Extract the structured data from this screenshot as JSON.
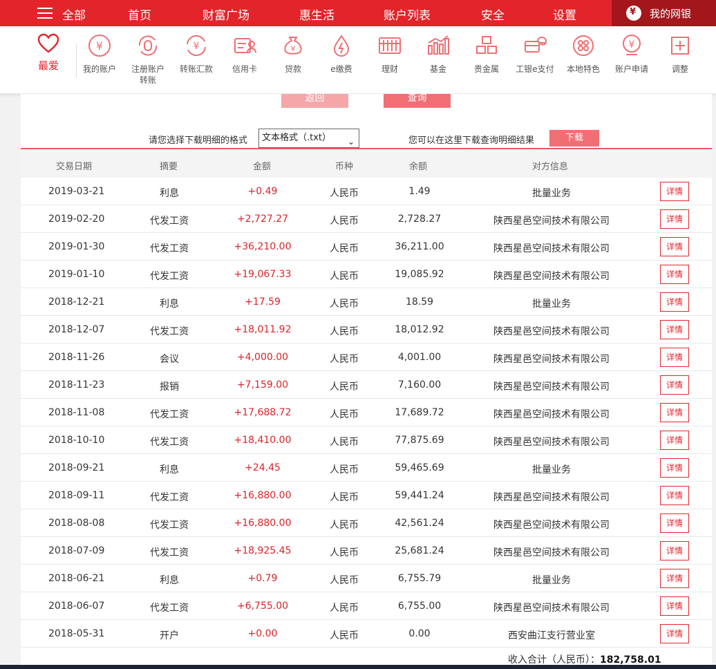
{
  "topnav": {
    "all_label": "全部",
    "items": [
      "首页",
      "财富广场",
      "惠生活",
      "账户列表",
      "安全",
      "设置"
    ],
    "mybank_label": "我的网银"
  },
  "iconbar": {
    "favorite_label": "最爱",
    "items": [
      {
        "label": "我的账户",
        "icon": "yen-circle-icon"
      },
      {
        "label": "注册账户转账",
        "icon": "register-transfer-icon"
      },
      {
        "label": "转账汇款",
        "icon": "transfer-icon"
      },
      {
        "label": "信用卡",
        "icon": "credit-card-icon"
      },
      {
        "label": "贷款",
        "icon": "loan-bag-icon"
      },
      {
        "label": "e缴费",
        "icon": "e-payment-icon"
      },
      {
        "label": "理财",
        "icon": "abacus-icon"
      },
      {
        "label": "基金",
        "icon": "fund-chart-icon"
      },
      {
        "label": "贵金属",
        "icon": "gold-bars-icon"
      },
      {
        "label": "工银e支付",
        "icon": "e-pay-icon"
      },
      {
        "label": "本地特色",
        "icon": "local-features-icon"
      },
      {
        "label": "账户申请",
        "icon": "account-apply-icon"
      },
      {
        "label": "调整",
        "icon": "plus-square-icon"
      }
    ]
  },
  "actions": {
    "back_label": "返回",
    "query_label": "查询"
  },
  "download": {
    "format_label": "请您选择下载明细的格式",
    "format_selected": "文本格式（.txt）",
    "hint": "您可以在这里下载查询明细结果",
    "button_label": "下载"
  },
  "table": {
    "headers": [
      "交易日期",
      "摘要",
      "金额",
      "币种",
      "余额",
      "对方信息"
    ],
    "detail_label": "详情",
    "rows": [
      {
        "date": "2019-03-21",
        "memo": "利息",
        "amount": "+0.49",
        "currency": "人民币",
        "balance": "1.49",
        "party": "批量业务"
      },
      {
        "date": "2019-02-20",
        "memo": "代发工资",
        "amount": "+2,727.27",
        "currency": "人民币",
        "balance": "2,728.27",
        "party": "陕西星邑空间技术有限公司"
      },
      {
        "date": "2019-01-30",
        "memo": "代发工资",
        "amount": "+36,210.00",
        "currency": "人民币",
        "balance": "36,211.00",
        "party": "陕西星邑空间技术有限公司"
      },
      {
        "date": "2019-01-10",
        "memo": "代发工资",
        "amount": "+19,067.33",
        "currency": "人民币",
        "balance": "19,085.92",
        "party": "陕西星邑空间技术有限公司"
      },
      {
        "date": "2018-12-21",
        "memo": "利息",
        "amount": "+17.59",
        "currency": "人民币",
        "balance": "18.59",
        "party": "批量业务"
      },
      {
        "date": "2018-12-07",
        "memo": "代发工资",
        "amount": "+18,011.92",
        "currency": "人民币",
        "balance": "18,012.92",
        "party": "陕西星邑空间技术有限公司"
      },
      {
        "date": "2018-11-26",
        "memo": "会议",
        "amount": "+4,000.00",
        "currency": "人民币",
        "balance": "4,001.00",
        "party": "陕西星邑空间技术有限公司"
      },
      {
        "date": "2018-11-23",
        "memo": "报销",
        "amount": "+7,159.00",
        "currency": "人民币",
        "balance": "7,160.00",
        "party": "陕西星邑空间技术有限公司"
      },
      {
        "date": "2018-11-08",
        "memo": "代发工资",
        "amount": "+17,688.72",
        "currency": "人民币",
        "balance": "17,689.72",
        "party": "陕西星邑空间技术有限公司"
      },
      {
        "date": "2018-10-10",
        "memo": "代发工资",
        "amount": "+18,410.00",
        "currency": "人民币",
        "balance": "77,875.69",
        "party": "陕西星邑空间技术有限公司"
      },
      {
        "date": "2018-09-21",
        "memo": "利息",
        "amount": "+24.45",
        "currency": "人民币",
        "balance": "59,465.69",
        "party": "批量业务"
      },
      {
        "date": "2018-09-11",
        "memo": "代发工资",
        "amount": "+16,880.00",
        "currency": "人民币",
        "balance": "59,441.24",
        "party": "陕西星邑空间技术有限公司"
      },
      {
        "date": "2018-08-08",
        "memo": "代发工资",
        "amount": "+16,880.00",
        "currency": "人民币",
        "balance": "42,561.24",
        "party": "陕西星邑空间技术有限公司"
      },
      {
        "date": "2018-07-09",
        "memo": "代发工资",
        "amount": "+18,925.45",
        "currency": "人民币",
        "balance": "25,681.24",
        "party": "陕西星邑空间技术有限公司"
      },
      {
        "date": "2018-06-21",
        "memo": "利息",
        "amount": "+0.79",
        "currency": "人民币",
        "balance": "6,755.79",
        "party": "批量业务"
      },
      {
        "date": "2018-06-07",
        "memo": "代发工资",
        "amount": "+6,755.00",
        "currency": "人民币",
        "balance": "6,755.00",
        "party": "陕西星邑空间技术有限公司"
      },
      {
        "date": "2018-05-31",
        "memo": "开户",
        "amount": "+0.00",
        "currency": "人民币",
        "balance": "0.00",
        "party": "西安曲江支行营业室"
      }
    ]
  },
  "summary": {
    "label": "收入合计（人民币）：",
    "value": "182,758.01"
  },
  "colors": {
    "brand_red": "#e3242b",
    "dark_red": "#a3161c",
    "amount_red": "#d9232a"
  }
}
